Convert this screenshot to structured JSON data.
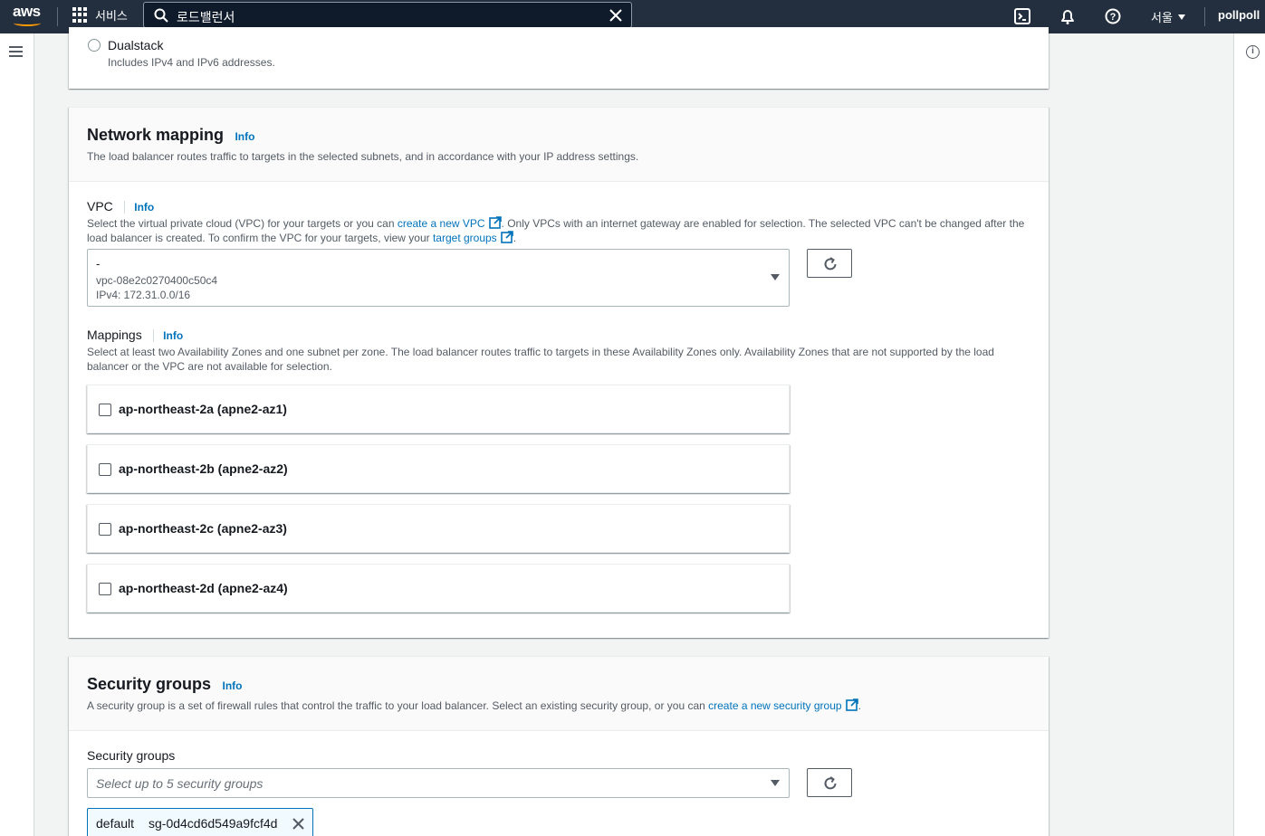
{
  "nav": {
    "logo_text": "aws",
    "services_label": "서비스",
    "search_value": "로드밸런서",
    "region_label": "서울",
    "account_label": "pollpoll"
  },
  "ip_section": {
    "dualstack_label": "Dualstack",
    "dualstack_desc": "Includes IPv4 and IPv6 addresses."
  },
  "network_mapping": {
    "title": "Network mapping",
    "info": "Info",
    "description": "The load balancer routes traffic to targets in the selected subnets, and in accordance with your IP address settings.",
    "vpc": {
      "label": "VPC",
      "info": "Info",
      "desc_part1": "Select the virtual private cloud (VPC) for your targets or you can ",
      "desc_link1": "create a new VPC",
      "desc_part2": ". Only VPCs with an internet gateway are enabled for selection. The selected VPC can't be changed after the load balancer is created. To confirm the VPC for your targets, view your ",
      "desc_link2": "target groups",
      "desc_part3": ".",
      "selected_name": "-",
      "selected_id": "vpc-08e2c0270400c50c4",
      "selected_cidr": "IPv4: 172.31.0.0/16"
    },
    "mappings": {
      "label": "Mappings",
      "info": "Info",
      "description": "Select at least two Availability Zones and one subnet per zone. The load balancer routes traffic to targets in these Availability Zones only. Availability Zones that are not supported by the load balancer or the VPC are not available for selection.",
      "zones": [
        {
          "label": "ap-northeast-2a (apne2-az1)",
          "checked": false
        },
        {
          "label": "ap-northeast-2b (apne2-az2)",
          "checked": false
        },
        {
          "label": "ap-northeast-2c (apne2-az3)",
          "checked": false
        },
        {
          "label": "ap-northeast-2d (apne2-az4)",
          "checked": false
        }
      ]
    }
  },
  "security_groups": {
    "title": "Security groups",
    "info": "Info",
    "desc_part1": "A security group is a set of firewall rules that control the traffic to your load balancer. Select an existing security group, or you can ",
    "desc_link": "create a new security group",
    "desc_part2": ".",
    "field_label": "Security groups",
    "placeholder": "Select up to 5 security groups",
    "selected": [
      {
        "name": "default",
        "id": "sg-0d4cd6d549a9fcf4d"
      }
    ]
  },
  "colors": {
    "nav_bg": "#232f3e",
    "link": "#0073bb",
    "aws_orange": "#ff9900",
    "page_bg": "#f2f3f3"
  }
}
